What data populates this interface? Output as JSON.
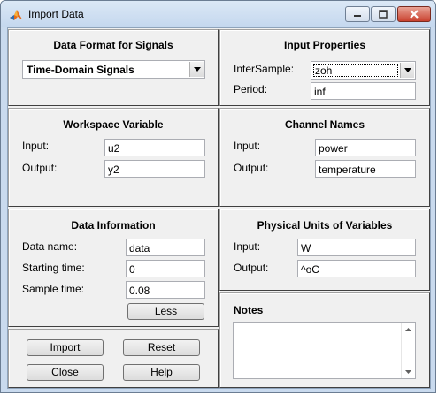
{
  "window": {
    "title": "Import Data",
    "icon": "matlab-icon"
  },
  "data_format": {
    "title": "Data Format for Signals",
    "selected": "Time-Domain Signals"
  },
  "input_properties": {
    "title": "Input Properties",
    "intersample_label": "InterSample:",
    "intersample_value": "zoh",
    "period_label": "Period:",
    "period_value": "inf"
  },
  "workspace_variable": {
    "title": "Workspace Variable",
    "input_label": "Input:",
    "input_value": "u2",
    "output_label": "Output:",
    "output_value": "y2"
  },
  "channel_names": {
    "title": "Channel Names",
    "input_label": "Input:",
    "input_value": "power",
    "output_label": "Output:",
    "output_value": "temperature"
  },
  "data_information": {
    "title": "Data Information",
    "name_label": "Data name:",
    "name_value": "data",
    "start_label": "Starting time:",
    "start_value": "0",
    "sample_label": "Sample time:",
    "sample_value": "0.08",
    "less_button": "Less"
  },
  "physical_units": {
    "title": "Physical Units of Variables",
    "input_label": "Input:",
    "input_value": "W",
    "output_label": "Output:",
    "output_value": "^oC"
  },
  "notes": {
    "title": "Notes",
    "value": ""
  },
  "buttons": {
    "import": "Import",
    "reset": "Reset",
    "close": "Close",
    "help": "Help"
  }
}
